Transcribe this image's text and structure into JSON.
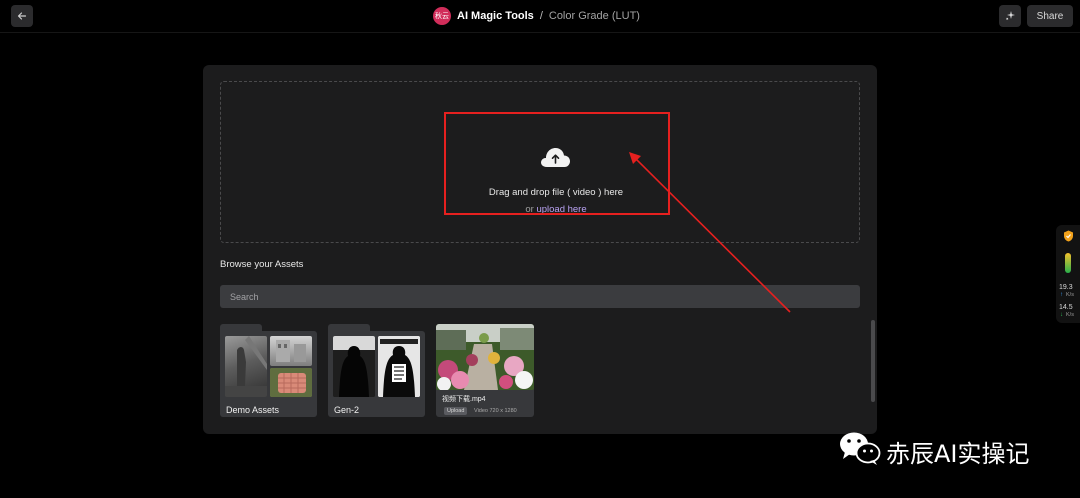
{
  "header": {
    "back_icon": "arrow-left-icon",
    "logo_text": "秋云",
    "app_name": "AI Magic Tools",
    "separator": "/",
    "page_title": "Color Grade (LUT)",
    "magic_icon": "sparkle-icon",
    "share_label": "Share"
  },
  "upload": {
    "icon": "cloud-upload-icon",
    "instruction": "Drag and drop file ( video ) here",
    "or_text": "or",
    "link_text": "upload here"
  },
  "assets": {
    "title": "Browse your Assets",
    "search_placeholder": "Search",
    "folders": [
      {
        "name": "Demo Assets"
      },
      {
        "name": "Gen-2"
      }
    ],
    "video": {
      "name": "视频下载.mp4",
      "badge": "Upload",
      "meta": "Video 720 x 1280"
    }
  },
  "widget": {
    "download_speed": "19.3",
    "download_unit": "K/s",
    "upload_speed": "14.5",
    "upload_unit": "K/s"
  },
  "watermark": {
    "text": "赤辰AI实操记",
    "icon": "wechat-icon"
  },
  "colors": {
    "accent_link": "#b9a2f2",
    "highlight_box": "#e6201f",
    "brand_logo": "#d12d5a"
  }
}
